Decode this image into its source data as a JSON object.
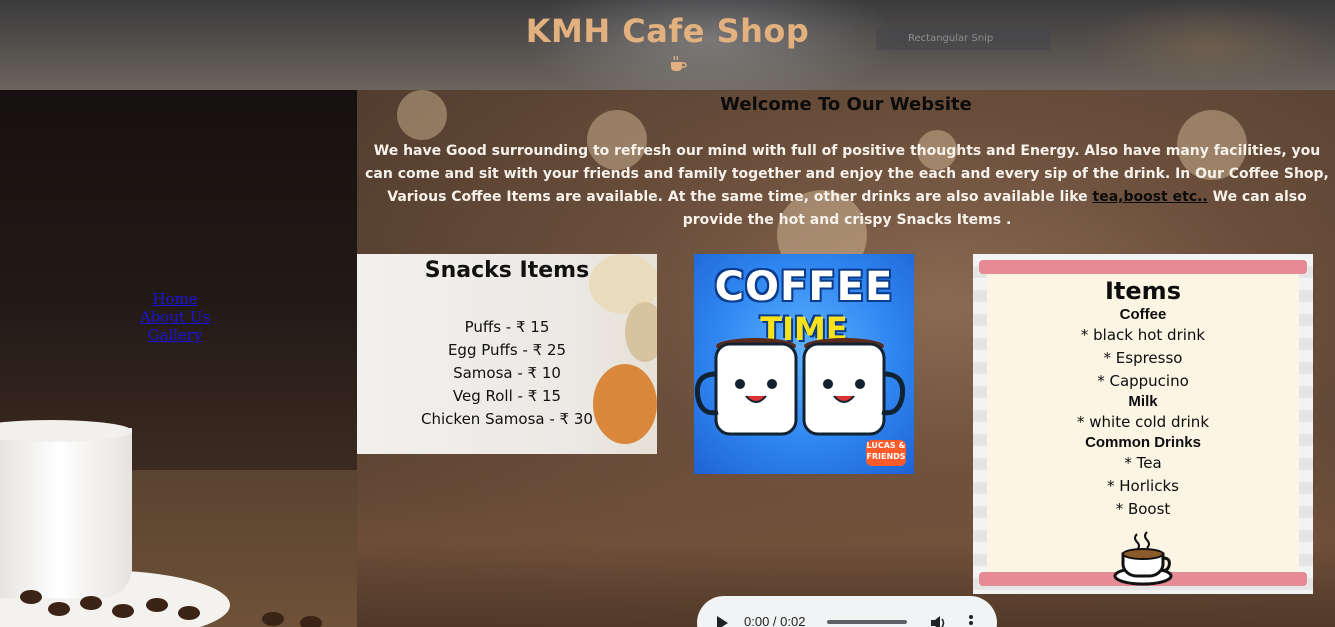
{
  "header": {
    "title": "KMH Cafe Shop",
    "overlay_text": "Rectangular Snip"
  },
  "nav": {
    "items": [
      {
        "label": "Home"
      },
      {
        "label": "About Us"
      },
      {
        "label": "Gallery"
      }
    ]
  },
  "main": {
    "welcome": "Welcome To Our Website",
    "intro_before": "We have Good surrounding to refresh our mind with full of positive thoughts and Energy. Also have many facilities, you can come and sit with your friends and family together and enjoy the each and every sip of the drink. In Our Coffee Shop, Various Coffee Items are available. At the same time, other drinks are also available like ",
    "intro_link": "tea,boost etc..",
    "intro_after": " We can also provide the hot and crispy Snacks Items ."
  },
  "snacks": {
    "title": "Snacks Items",
    "items": [
      "Puffs - ₹ 15",
      "Egg Puffs - ₹ 25",
      "Samosa - ₹ 10",
      "Veg Roll - ₹ 15",
      "Chicken Samosa - ₹ 30"
    ]
  },
  "coffee_image": {
    "word1": "COFFEE",
    "word2": "TIME",
    "badge": "LUCAS & FRIENDS"
  },
  "menu": {
    "title": "Items",
    "categories": [
      {
        "name": "Coffee",
        "items": [
          "* black hot drink",
          "* Espresso",
          "* Cappucino"
        ]
      },
      {
        "name": "Milk",
        "items": [
          "* white cold drink"
        ]
      },
      {
        "name": "Common Drinks",
        "items": [
          "* Tea",
          "* Horlicks",
          "* Boost"
        ]
      }
    ]
  },
  "audio": {
    "time": "0:00 / 0:02"
  },
  "colors": {
    "title": "#e3b07f",
    "link": "#1a14d9",
    "menu_bar": "#e68a95"
  }
}
